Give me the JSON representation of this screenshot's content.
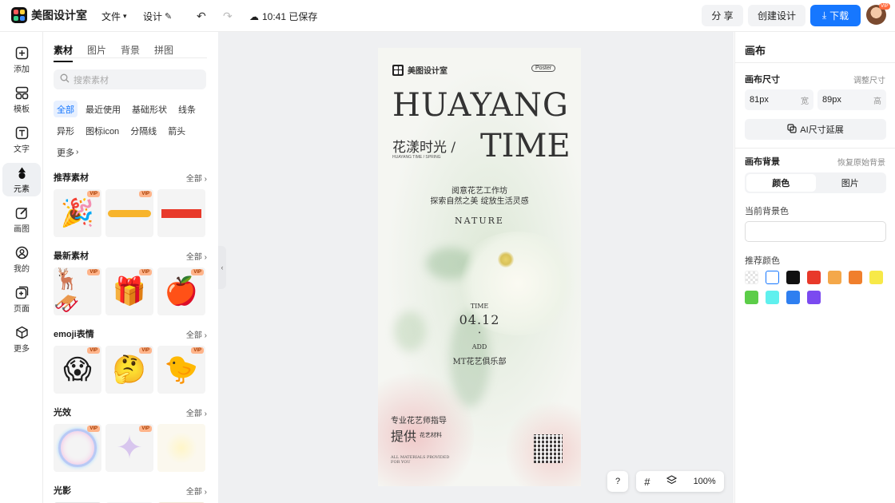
{
  "app": {
    "name": "美图设计室"
  },
  "topbar": {
    "file_label": "文件",
    "design_label": "设计",
    "saved_status": "10:41 已保存",
    "share_label": "分 享",
    "create_label": "创建设计",
    "download_label": "下载",
    "avatar_badge": "VIP",
    "accent": "#1677ff"
  },
  "rail": {
    "items": [
      {
        "label": "添加",
        "icon": "plus-square-icon"
      },
      {
        "label": "模板",
        "icon": "template-icon"
      },
      {
        "label": "文字",
        "icon": "text-icon"
      },
      {
        "label": "元素",
        "icon": "shapes-icon",
        "active": true
      },
      {
        "label": "画图",
        "icon": "pen-square-icon"
      },
      {
        "label": "我的",
        "icon": "user-icon"
      },
      {
        "label": "页面",
        "icon": "page-add-icon"
      },
      {
        "label": "更多",
        "icon": "cube-icon"
      }
    ]
  },
  "panel": {
    "tabs": [
      "素材",
      "图片",
      "背景",
      "拼图"
    ],
    "search_placeholder": "搜索素材",
    "chips": [
      "全部",
      "最近使用",
      "基础形状",
      "线条",
      "异形",
      "图标icon",
      "分隔线",
      "箭头",
      "更多"
    ],
    "vip_label": "VIP",
    "all_label": "全部",
    "sections": [
      {
        "title": "推荐素材",
        "items": [
          "party-popper",
          "yellow-brush-stroke",
          "red-bar"
        ]
      },
      {
        "title": "最新素材",
        "items": [
          "reindeer-sleigh",
          "christmas-gift",
          "red-apple"
        ]
      },
      {
        "title": "emoji表情",
        "items": [
          "shocked-face",
          "thinking-face",
          "chick-sign"
        ]
      },
      {
        "title": "光效",
        "items": [
          "bubble-ring",
          "sparkle-star",
          "soft-glow"
        ]
      },
      {
        "title": "光影",
        "items": []
      }
    ]
  },
  "poster": {
    "brand": "美图设计室",
    "badge": "Poster",
    "title_line1": "HUAYANG",
    "title_line2": "TIME",
    "title_cn": "花漾时光 /",
    "subtitle_small": "HUAYANG TIME / SPRING",
    "tagline1": "阅意花艺工作坊",
    "tagline2": "探索自然之美 绽放生活灵感",
    "nature": "NATURE",
    "time_label": "TIME",
    "date": "04.12",
    "add_label": "ADD",
    "venue": "MT花艺俱乐部",
    "bottom_line1": "专业花艺师指导",
    "bottom_line2": "提供",
    "bottom_line2b": "花艺材料",
    "bottom_small": "ALL MATERIALS PROVIDED FOR YOU"
  },
  "canvas_tools": {
    "help": "?",
    "zoom": "100%"
  },
  "right": {
    "title": "画布",
    "size_label": "画布尺寸",
    "size_link": "调整尺寸",
    "width_value": "81px",
    "width_unit": "宽",
    "height_value": "89px",
    "height_unit": "高",
    "ai_button": "AI尺寸延展",
    "bg_label": "画布背景",
    "bg_link": "恢复原始背景",
    "seg_color": "颜色",
    "seg_image": "图片",
    "current_bg_label": "当前背景色",
    "current_bg_value": "#ffffff",
    "recommend_label": "推荐颜色",
    "swatches": [
      "transparent",
      "#ffffff",
      "#111111",
      "#e8392a",
      "#f4a84a",
      "#f07f2d",
      "#f7e948",
      "#5ccd48",
      "#5ff0ee",
      "#2f7ff0",
      "#7b4af0"
    ]
  }
}
